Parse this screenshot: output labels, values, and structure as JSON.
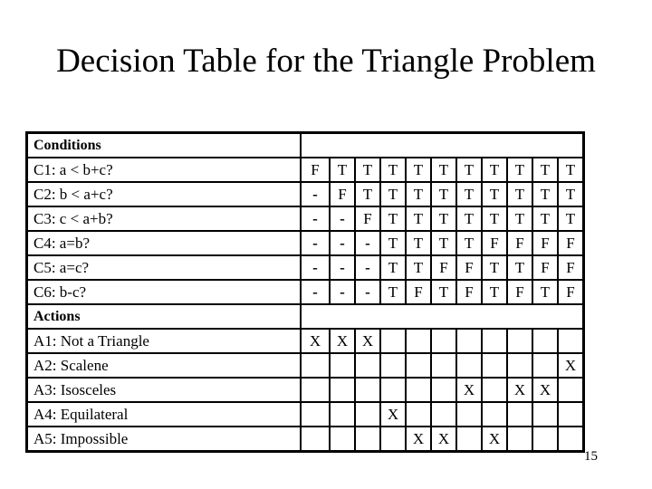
{
  "title": "Decision Table for the Triangle Problem",
  "page_number": "15",
  "conditions": {
    "header": "Conditions",
    "rows": [
      {
        "label": "C1:  a < b+c?",
        "values": [
          "F",
          "T",
          "T",
          "T",
          "T",
          "T",
          "T",
          "T",
          "T",
          "T",
          "T"
        ]
      },
      {
        "label": "C2: b < a+c?",
        "values": [
          "-",
          "F",
          "T",
          "T",
          "T",
          "T",
          "T",
          "T",
          "T",
          "T",
          "T"
        ]
      },
      {
        "label": "C3: c < a+b?",
        "values": [
          "-",
          "-",
          "F",
          "T",
          "T",
          "T",
          "T",
          "T",
          "T",
          "T",
          "T"
        ]
      },
      {
        "label": "C4: a=b?",
        "values": [
          "-",
          "-",
          "-",
          "T",
          "T",
          "T",
          "T",
          "F",
          "F",
          "F",
          "F"
        ]
      },
      {
        "label": "C5: a=c?",
        "values": [
          "-",
          "-",
          "-",
          "T",
          "T",
          "F",
          "F",
          "T",
          "T",
          "F",
          "F"
        ]
      },
      {
        "label": "C6: b-c?",
        "values": [
          "-",
          "-",
          "-",
          "T",
          "F",
          "T",
          "F",
          "T",
          "F",
          "T",
          "F"
        ]
      }
    ]
  },
  "actions": {
    "header": "Actions",
    "rows": [
      {
        "label": "A1: Not a Triangle",
        "values": [
          "X",
          "X",
          "X",
          "",
          "",
          "",
          "",
          "",
          "",
          "",
          ""
        ]
      },
      {
        "label": "A2: Scalene",
        "values": [
          "",
          "",
          "",
          "",
          "",
          "",
          "",
          "",
          "",
          "",
          "X"
        ]
      },
      {
        "label": "A3: Isosceles",
        "values": [
          "",
          "",
          "",
          "",
          "",
          "",
          "X",
          "",
          "X",
          "X",
          ""
        ]
      },
      {
        "label": "A4: Equilateral",
        "values": [
          "",
          "",
          "",
          "X",
          "",
          "",
          "",
          "",
          "",
          "",
          ""
        ]
      },
      {
        "label": "A5: Impossible",
        "values": [
          "",
          "",
          "",
          "",
          "X",
          "X",
          "",
          "X",
          "",
          "",
          ""
        ]
      }
    ]
  }
}
